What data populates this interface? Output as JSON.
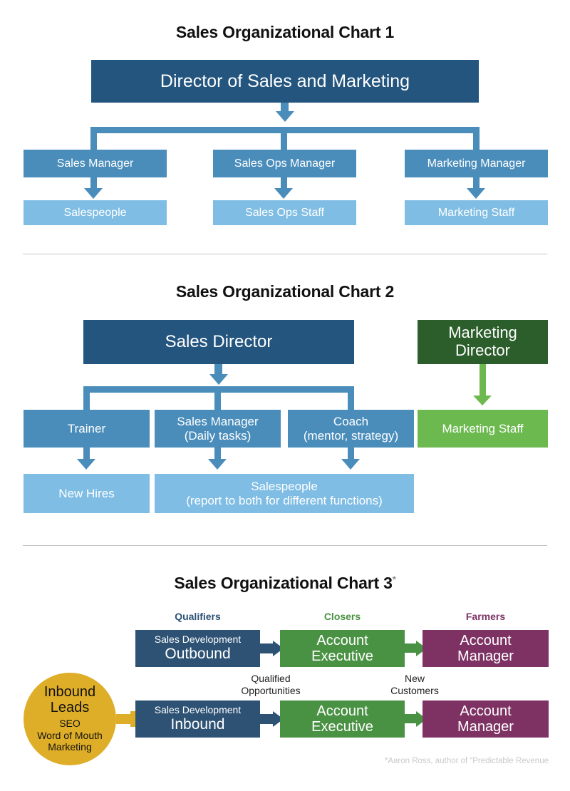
{
  "chart1": {
    "title": "Sales Organizational Chart 1",
    "root": "Director of Sales and Marketing",
    "managers": [
      "Sales Manager",
      "Sales Ops Manager",
      "Marketing Manager"
    ],
    "staff": [
      "Salespeople",
      "Sales Ops Staff",
      "Marketing Staff"
    ],
    "colors": {
      "root": "#24557e",
      "manager": "#4a8dbb",
      "staff": "#7fbde4",
      "connector": "#4a8dbb"
    }
  },
  "chart2": {
    "title": "Sales Organizational Chart 2",
    "sales_director": "Sales Director",
    "marketing_director_line1": "Marketing",
    "marketing_director_line2": "Director",
    "marketing_staff": "Marketing Staff",
    "roles": [
      {
        "line1": "Trainer",
        "line2": ""
      },
      {
        "line1": "Sales Manager",
        "line2": "(Daily tasks)"
      },
      {
        "line1": "Coach",
        "line2": "(mentor, strategy)"
      }
    ],
    "new_hires": "New Hires",
    "salespeople_line1": "Salespeople",
    "salespeople_line2": "(report to both for different functions)",
    "colors": {
      "director": "#24557e",
      "role": "#4a8dbb",
      "staff": "#7fbde4",
      "marketing_director": "#2b5e2b",
      "marketing_staff": "#6cb94f"
    }
  },
  "chart3": {
    "title": "Sales Organizational Chart 3",
    "title_superscript": "*",
    "columns": [
      "Qualifiers",
      "Closers",
      "Farmers"
    ],
    "rows": [
      {
        "stage1_small": "Sales Development",
        "stage1_big": "Outbound",
        "stage2_line1": "Account",
        "stage2_line2": "Executive",
        "stage3_line1": "Account",
        "stage3_line2": "Manager"
      },
      {
        "stage1_small": "Sales Development",
        "stage1_big": "Inbound",
        "stage2_line1": "Account",
        "stage2_line2": "Executive",
        "stage3_line1": "Account",
        "stage3_line2": "Manager"
      }
    ],
    "circle": {
      "line1": "Inbound",
      "line2": "Leads",
      "line3": "SEO",
      "line4": "Word of Mouth",
      "line5": "Marketing"
    },
    "flow_labels": {
      "qualified_line1": "Qualified",
      "qualified_line2": "Opportunities",
      "new_line1": "New",
      "new_line2": "Customers"
    },
    "footnote": "*Aaron Ross, author of “Predictable Revenue",
    "colors": {
      "qualifiers": "#2d5274",
      "closers": "#4a9243",
      "farmers": "#7d3263",
      "inbound_leads": "#dfae28"
    }
  }
}
